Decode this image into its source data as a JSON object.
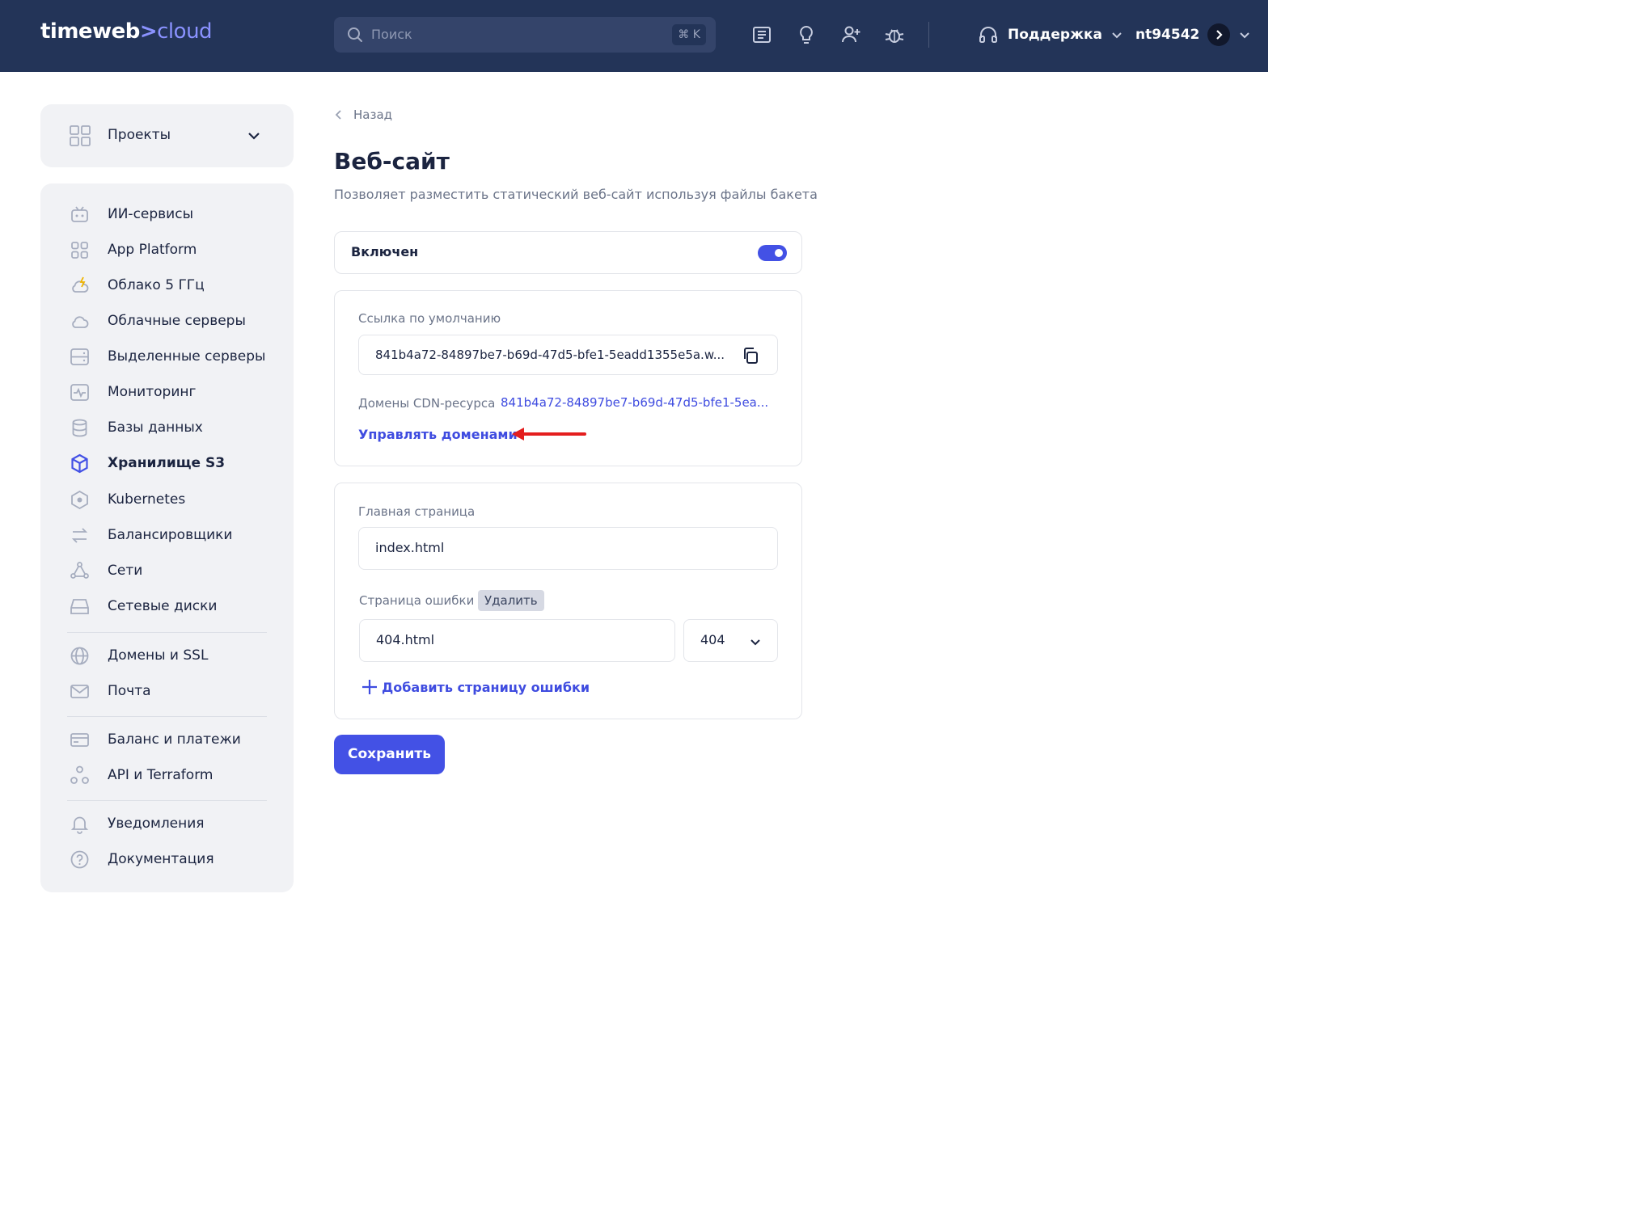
{
  "header": {
    "logo_main": "timeweb",
    "logo_sep": ">",
    "logo_accent": "cloud",
    "search_placeholder": "Поиск",
    "search_shortcut": "⌘ K",
    "support_label": "Поддержка",
    "username": "nt94542"
  },
  "sidebar": {
    "projects_label": "Проекты",
    "items": [
      {
        "label": "ИИ-сервисы",
        "icon": "robot-icon"
      },
      {
        "label": "App Platform",
        "icon": "apps-grid-icon"
      },
      {
        "label": "Облако 5 ГГц",
        "icon": "cloud-bolt-icon"
      },
      {
        "label": "Облачные серверы",
        "icon": "cloud-icon"
      },
      {
        "label": "Выделенные серверы",
        "icon": "server-icon"
      },
      {
        "label": "Мониторинг",
        "icon": "monitoring-icon"
      },
      {
        "label": "Базы данных",
        "icon": "database-icon"
      },
      {
        "label": "Хранилище S3",
        "icon": "cube-icon",
        "active": true
      },
      {
        "label": "Kubernetes",
        "icon": "kubernetes-icon"
      },
      {
        "label": "Балансировщики",
        "icon": "balancer-icon"
      },
      {
        "label": "Сети",
        "icon": "network-icon"
      },
      {
        "label": "Сетевые диски",
        "icon": "disk-icon"
      },
      {
        "label": "Домены и SSL",
        "icon": "globe-icon"
      },
      {
        "label": "Почта",
        "icon": "mail-icon"
      },
      {
        "label": "Баланс и платежи",
        "icon": "card-icon"
      },
      {
        "label": "API и Terraform",
        "icon": "api-icon"
      },
      {
        "label": "Уведомления",
        "icon": "bell-icon"
      },
      {
        "label": "Документация",
        "icon": "help-icon"
      }
    ]
  },
  "main": {
    "back_label": "Назад",
    "title": "Веб-сайт",
    "subtitle": "Позволяет разместить статический веб-сайт используя файлы бакета",
    "enabled_label": "Включен",
    "enabled": true,
    "default_link_label": "Ссылка по умолчанию",
    "default_link_value": "841b4a72-84897be7-b69d-47d5-bfe1-5eadd1355e5a.w...",
    "cdn_label": "Домены CDN-ресурса",
    "cdn_value": "841b4a72-84897be7-b69d-47d5-bfe1-5ea...",
    "manage_domains": "Управлять доменами",
    "index_label": "Главная страница",
    "index_value": "index.html",
    "error_label": "Страница ошибки",
    "delete_label": "Удалить",
    "error_value": "404.html",
    "error_code": "404",
    "add_error_page": "Добавить страницу ошибки",
    "save_label": "Сохранить"
  },
  "colors": {
    "header_bg": "#233458",
    "accent": "#4351e5",
    "annotation_arrow": "#e41e1e"
  }
}
